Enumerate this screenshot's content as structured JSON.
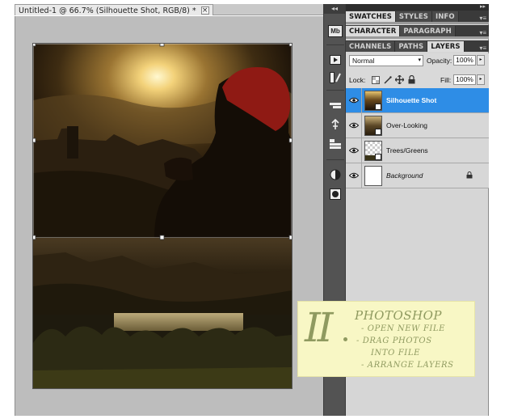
{
  "document": {
    "tab_title": "Untitled-1 @ 66.7% (Silhouette Shot, RGB/8) *",
    "close_glyph": "×"
  },
  "tool_strip": {
    "collapse_glyph": "◂◂",
    "icons": [
      "mini-bridge-icon",
      "play-icon",
      "brush-preset-icon",
      "tool-presets-icon",
      "clone-source-icon",
      "history-icon",
      "adjustments-icon",
      "masks-icon"
    ],
    "mini_bridge_label": "Mb"
  },
  "panels": {
    "collapse_glyph": "▸▸",
    "tabs_row1": [
      {
        "label": "SWATCHES",
        "active": true
      },
      {
        "label": "STYLES",
        "active": false
      },
      {
        "label": "INFO",
        "active": false
      }
    ],
    "tabs_row2": [
      {
        "label": "CHARACTER",
        "active": true
      },
      {
        "label": "PARAGRAPH",
        "active": false
      }
    ],
    "tabs_row3": [
      {
        "label": "CHANNELS",
        "active": false
      },
      {
        "label": "PATHS",
        "active": false
      },
      {
        "label": "LAYERS",
        "active": true
      }
    ],
    "menu_glyph": "▾≡"
  },
  "layer_options": {
    "blend_mode": "Normal",
    "opacity_label": "Opacity:",
    "opacity_value": "100%",
    "lock_label": "Lock:",
    "fill_label": "Fill:",
    "fill_value": "100%",
    "arrow_glyph": "▸",
    "dropdown_glyph": "▾"
  },
  "layers": [
    {
      "name": "Silhouette Shot",
      "selected": true,
      "visible": true,
      "thumb": "photo-silhouette",
      "italic": false,
      "locked": false
    },
    {
      "name": "Over-Looking",
      "selected": false,
      "visible": true,
      "thumb": "photo-overlook",
      "italic": false,
      "locked": false
    },
    {
      "name": "Trees/Greens",
      "selected": false,
      "visible": true,
      "thumb": "transparent",
      "italic": false,
      "locked": false
    },
    {
      "name": "Background",
      "selected": false,
      "visible": true,
      "thumb": "white",
      "italic": true,
      "locked": true
    }
  ],
  "note": {
    "numeral": "II",
    "title": "PHOTOSHOP",
    "lines": [
      "- OPEN NEW FILE",
      "- DRAG PHOTOS",
      "INTO FILE",
      "- ARRANGE LAYERS"
    ],
    "color": "#8f9a60",
    "background": "#f8f7c5"
  },
  "colors": {
    "selection_blue": "#2e8de6",
    "panel_gray": "#d6d6d6",
    "dark_strip": "#535353"
  }
}
